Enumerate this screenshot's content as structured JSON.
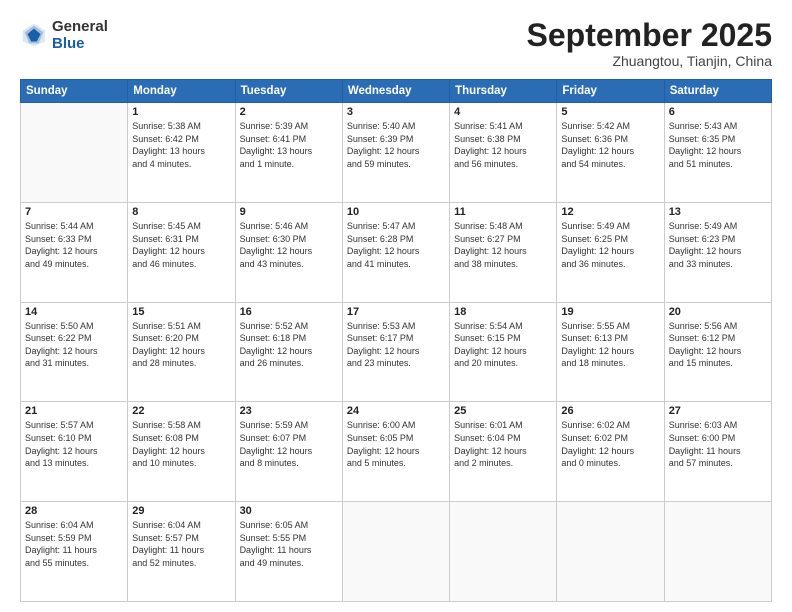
{
  "header": {
    "logo_line1": "General",
    "logo_line2": "Blue",
    "month": "September 2025",
    "location": "Zhuangtou, Tianjin, China"
  },
  "weekdays": [
    "Sunday",
    "Monday",
    "Tuesday",
    "Wednesday",
    "Thursday",
    "Friday",
    "Saturday"
  ],
  "weeks": [
    [
      {
        "day": "",
        "info": ""
      },
      {
        "day": "1",
        "info": "Sunrise: 5:38 AM\nSunset: 6:42 PM\nDaylight: 13 hours\nand 4 minutes."
      },
      {
        "day": "2",
        "info": "Sunrise: 5:39 AM\nSunset: 6:41 PM\nDaylight: 13 hours\nand 1 minute."
      },
      {
        "day": "3",
        "info": "Sunrise: 5:40 AM\nSunset: 6:39 PM\nDaylight: 12 hours\nand 59 minutes."
      },
      {
        "day": "4",
        "info": "Sunrise: 5:41 AM\nSunset: 6:38 PM\nDaylight: 12 hours\nand 56 minutes."
      },
      {
        "day": "5",
        "info": "Sunrise: 5:42 AM\nSunset: 6:36 PM\nDaylight: 12 hours\nand 54 minutes."
      },
      {
        "day": "6",
        "info": "Sunrise: 5:43 AM\nSunset: 6:35 PM\nDaylight: 12 hours\nand 51 minutes."
      }
    ],
    [
      {
        "day": "7",
        "info": "Sunrise: 5:44 AM\nSunset: 6:33 PM\nDaylight: 12 hours\nand 49 minutes."
      },
      {
        "day": "8",
        "info": "Sunrise: 5:45 AM\nSunset: 6:31 PM\nDaylight: 12 hours\nand 46 minutes."
      },
      {
        "day": "9",
        "info": "Sunrise: 5:46 AM\nSunset: 6:30 PM\nDaylight: 12 hours\nand 43 minutes."
      },
      {
        "day": "10",
        "info": "Sunrise: 5:47 AM\nSunset: 6:28 PM\nDaylight: 12 hours\nand 41 minutes."
      },
      {
        "day": "11",
        "info": "Sunrise: 5:48 AM\nSunset: 6:27 PM\nDaylight: 12 hours\nand 38 minutes."
      },
      {
        "day": "12",
        "info": "Sunrise: 5:49 AM\nSunset: 6:25 PM\nDaylight: 12 hours\nand 36 minutes."
      },
      {
        "day": "13",
        "info": "Sunrise: 5:49 AM\nSunset: 6:23 PM\nDaylight: 12 hours\nand 33 minutes."
      }
    ],
    [
      {
        "day": "14",
        "info": "Sunrise: 5:50 AM\nSunset: 6:22 PM\nDaylight: 12 hours\nand 31 minutes."
      },
      {
        "day": "15",
        "info": "Sunrise: 5:51 AM\nSunset: 6:20 PM\nDaylight: 12 hours\nand 28 minutes."
      },
      {
        "day": "16",
        "info": "Sunrise: 5:52 AM\nSunset: 6:18 PM\nDaylight: 12 hours\nand 26 minutes."
      },
      {
        "day": "17",
        "info": "Sunrise: 5:53 AM\nSunset: 6:17 PM\nDaylight: 12 hours\nand 23 minutes."
      },
      {
        "day": "18",
        "info": "Sunrise: 5:54 AM\nSunset: 6:15 PM\nDaylight: 12 hours\nand 20 minutes."
      },
      {
        "day": "19",
        "info": "Sunrise: 5:55 AM\nSunset: 6:13 PM\nDaylight: 12 hours\nand 18 minutes."
      },
      {
        "day": "20",
        "info": "Sunrise: 5:56 AM\nSunset: 6:12 PM\nDaylight: 12 hours\nand 15 minutes."
      }
    ],
    [
      {
        "day": "21",
        "info": "Sunrise: 5:57 AM\nSunset: 6:10 PM\nDaylight: 12 hours\nand 13 minutes."
      },
      {
        "day": "22",
        "info": "Sunrise: 5:58 AM\nSunset: 6:08 PM\nDaylight: 12 hours\nand 10 minutes."
      },
      {
        "day": "23",
        "info": "Sunrise: 5:59 AM\nSunset: 6:07 PM\nDaylight: 12 hours\nand 8 minutes."
      },
      {
        "day": "24",
        "info": "Sunrise: 6:00 AM\nSunset: 6:05 PM\nDaylight: 12 hours\nand 5 minutes."
      },
      {
        "day": "25",
        "info": "Sunrise: 6:01 AM\nSunset: 6:04 PM\nDaylight: 12 hours\nand 2 minutes."
      },
      {
        "day": "26",
        "info": "Sunrise: 6:02 AM\nSunset: 6:02 PM\nDaylight: 12 hours\nand 0 minutes."
      },
      {
        "day": "27",
        "info": "Sunrise: 6:03 AM\nSunset: 6:00 PM\nDaylight: 11 hours\nand 57 minutes."
      }
    ],
    [
      {
        "day": "28",
        "info": "Sunrise: 6:04 AM\nSunset: 5:59 PM\nDaylight: 11 hours\nand 55 minutes."
      },
      {
        "day": "29",
        "info": "Sunrise: 6:04 AM\nSunset: 5:57 PM\nDaylight: 11 hours\nand 52 minutes."
      },
      {
        "day": "30",
        "info": "Sunrise: 6:05 AM\nSunset: 5:55 PM\nDaylight: 11 hours\nand 49 minutes."
      },
      {
        "day": "",
        "info": ""
      },
      {
        "day": "",
        "info": ""
      },
      {
        "day": "",
        "info": ""
      },
      {
        "day": "",
        "info": ""
      }
    ]
  ]
}
